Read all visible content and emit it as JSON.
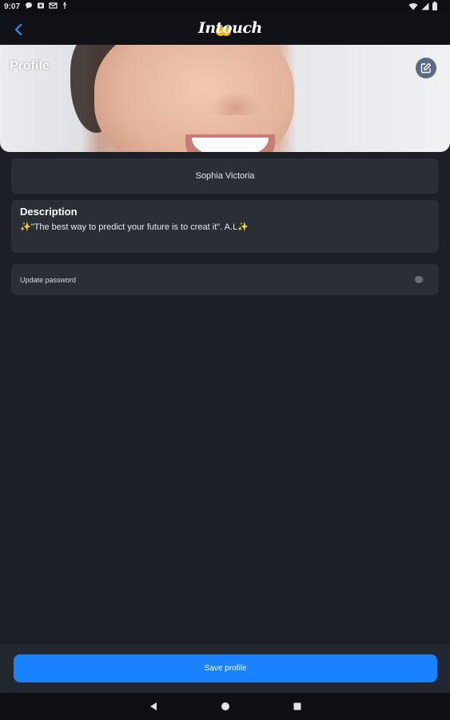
{
  "status_bar": {
    "time": "9:07",
    "icons": [
      "chat-icon",
      "media-icon",
      "gmail-icon",
      "accessibility-icon",
      "wifi-icon",
      "signal-icon",
      "battery-icon"
    ]
  },
  "header": {
    "logo_text": "Intouch",
    "back_icon": "chevron-left-icon"
  },
  "hero": {
    "title": "Profile",
    "edit_icon": "edit-icon"
  },
  "profile": {
    "name": "Sophia Victoria",
    "description_title": "Description",
    "description_text": "✨\"The best way to predict your future is to creat it\". A.L✨"
  },
  "settings": {
    "update_password_label": "Update password",
    "update_password_enabled": false
  },
  "footer": {
    "save_label": "Save profile"
  },
  "colors": {
    "background": "#1c1f26",
    "card": "#2a2e36",
    "accent": "#1a82ff",
    "back_icon": "#2f8bff"
  }
}
